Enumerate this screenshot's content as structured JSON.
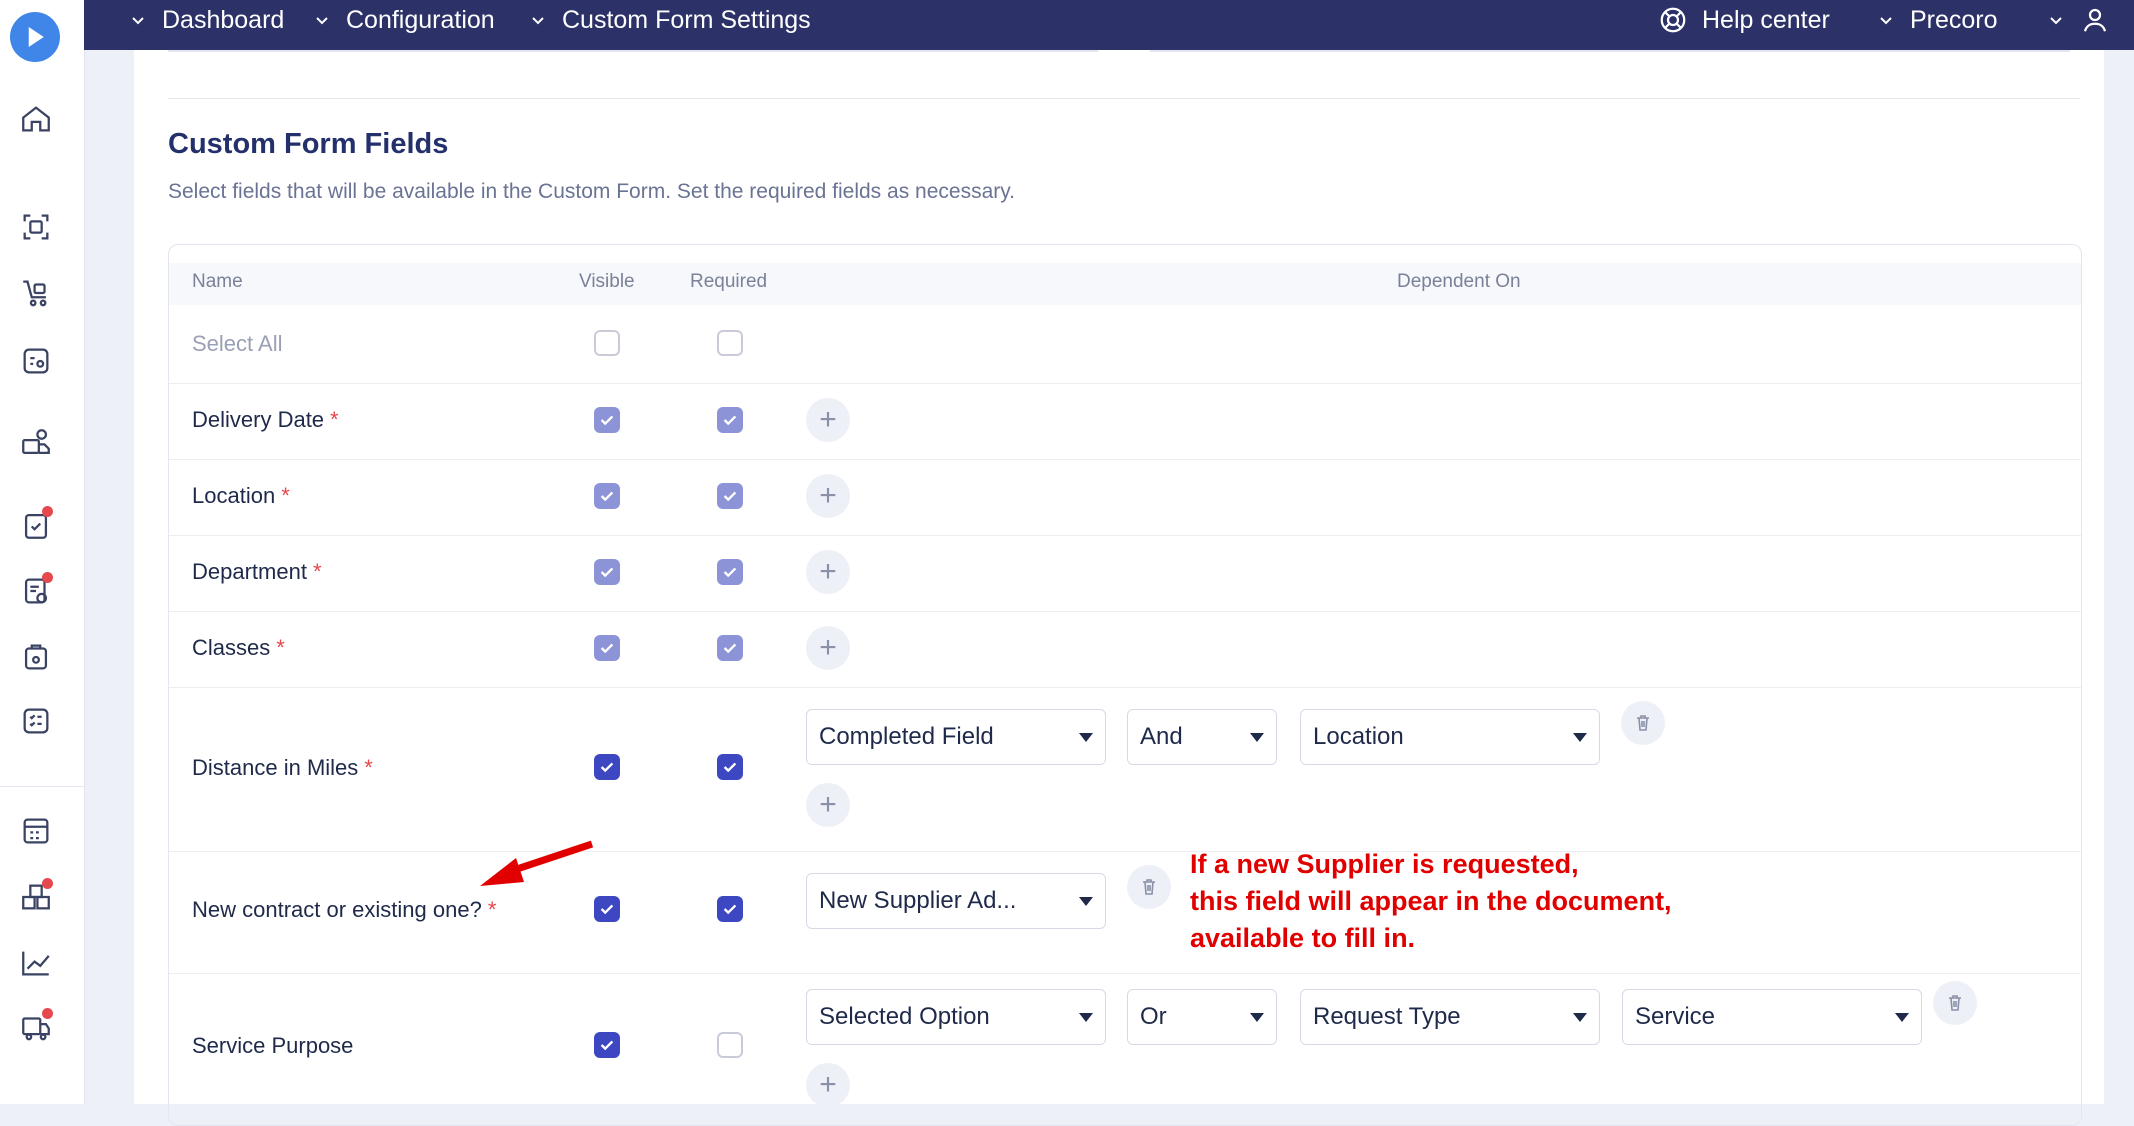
{
  "breadcrumbs": [
    "Dashboard",
    "Configuration",
    "Custom Form Settings"
  ],
  "topbar": {
    "help_label": "Help center",
    "company_label": "Precoro"
  },
  "section": {
    "title": "Custom Form Fields",
    "subtitle": "Select fields that will be available in the Custom Form. Set the required fields as necessary."
  },
  "table": {
    "headers": {
      "name": "Name",
      "visible": "Visible",
      "required": "Required",
      "dependent": "Dependent On"
    },
    "select_all_label": "Select All",
    "rows": [
      {
        "name": "Delivery Date",
        "required_mark": "*",
        "visible": true,
        "required": true,
        "enabled": false
      },
      {
        "name": "Location",
        "required_mark": "*",
        "visible": true,
        "required": true,
        "enabled": false
      },
      {
        "name": "Department",
        "required_mark": "*",
        "visible": true,
        "required": true,
        "enabled": false
      },
      {
        "name": "Classes",
        "required_mark": "*",
        "visible": true,
        "required": true,
        "enabled": false
      },
      {
        "name": "Distance in Miles",
        "required_mark": "*",
        "visible": true,
        "required": true,
        "enabled": true,
        "dependency": {
          "condition": "Completed Field",
          "operator": "And",
          "field": "Location"
        }
      },
      {
        "name": "New contract or existing one?",
        "required_mark": "*",
        "visible": true,
        "required": true,
        "enabled": true,
        "dependency": {
          "condition": "New Supplier Ad..."
        }
      },
      {
        "name": "Service Purpose",
        "required_mark": "",
        "visible": true,
        "required": false,
        "enabled": true,
        "dependency": {
          "condition": "Selected Option",
          "operator": "Or",
          "field": "Request Type",
          "value": "Service"
        }
      }
    ]
  },
  "annotation": {
    "text": "If a new Supplier is requested,\n this field will appear in the document,\navailable to fill in.",
    "color": "#e00000"
  },
  "colors": {
    "topbar": "#2c3168",
    "accent": "#3d47c1",
    "accent_light": "#8c93d6",
    "required_star": "#e5484d"
  },
  "sidebar_icons": [
    "home-icon",
    "scan-icon",
    "cart-icon",
    "approval-icon",
    "supplier-icon",
    "tasks-icon",
    "documents-icon",
    "inventory-icon",
    "reports-list-icon",
    "budget-icon",
    "warehouse-icon",
    "analytics-icon",
    "delivery-icon"
  ]
}
